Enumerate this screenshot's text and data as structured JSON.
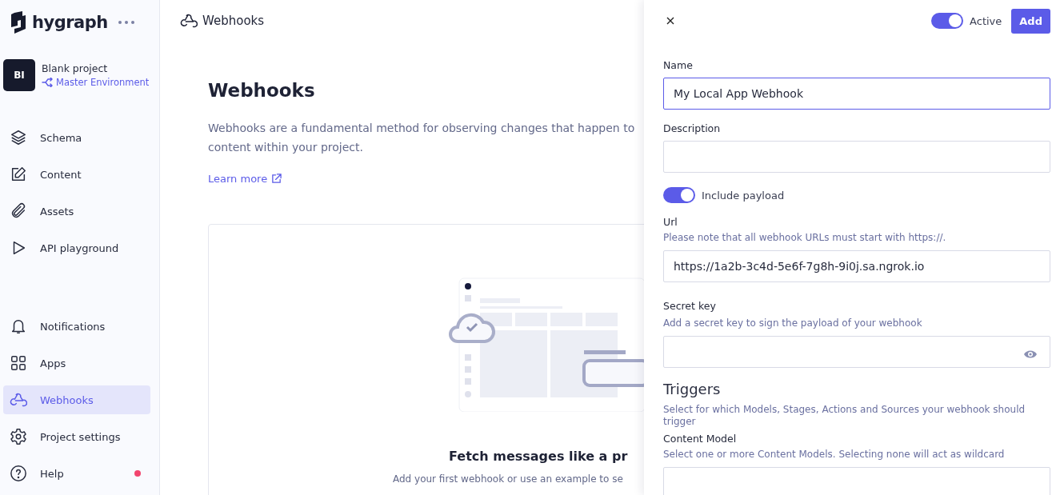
{
  "sidebar": {
    "brand": "hygraph",
    "project": {
      "initials": "BI",
      "name": "Blank project",
      "environment": "Master Environment"
    },
    "nav_top": [
      {
        "label": "Schema",
        "selected": false
      },
      {
        "label": "Content",
        "selected": false
      },
      {
        "label": "Assets",
        "selected": false
      },
      {
        "label": "API playground",
        "selected": false
      }
    ],
    "nav_bottom": [
      {
        "label": "Notifications",
        "selected": false,
        "dot": false
      },
      {
        "label": "Apps",
        "selected": false,
        "dot": false
      },
      {
        "label": "Webhooks",
        "selected": true,
        "dot": false
      },
      {
        "label": "Project settings",
        "selected": false,
        "dot": false
      },
      {
        "label": "Help",
        "selected": false,
        "dot": true
      }
    ]
  },
  "header": {
    "title": "Webhooks"
  },
  "main": {
    "title": "Webhooks",
    "description": "Webhooks are a fundamental method for observing changes that happen to content within your project.",
    "learn_more": "Learn more",
    "empty_state": {
      "title": "Fetch messages like a pr",
      "text": "Add your first webhook or use an example to se"
    }
  },
  "drawer": {
    "active": {
      "label": "Active",
      "on": true
    },
    "add_button": "Add",
    "name": {
      "label": "Name",
      "value": "My Local App Webhook"
    },
    "description": {
      "label": "Description"
    },
    "include_payload": {
      "label": "Include payload",
      "on": true
    },
    "url": {
      "label": "Url",
      "hint": "Please note that all webhook URLs must start with https://.",
      "value": "https://1a2b-3c4d-5e6f-7g8h-9i0j.sa.ngrok.io"
    },
    "secret_key": {
      "label": "Secret key",
      "hint": "Add a secret key to sign the payload of your webhook"
    },
    "triggers": {
      "title": "Triggers",
      "hint": "Select for which Models, Stages, Actions and Sources your webhook should trigger"
    },
    "content_model": {
      "label": "Content Model",
      "hint": "Select one or more Content Models. Selecting none will act as wildcard"
    }
  }
}
